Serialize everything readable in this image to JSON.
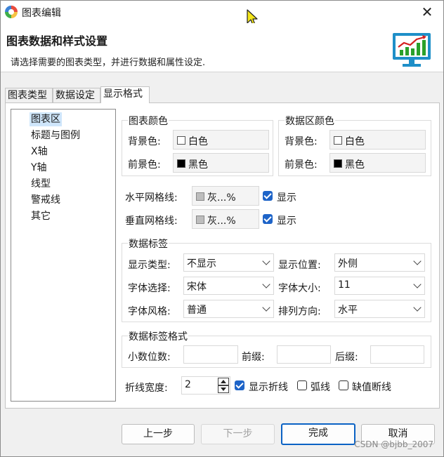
{
  "window": {
    "title": "图表编辑"
  },
  "header": {
    "title": "图表数据和样式设置",
    "subtitle": "请选择需要的图表类型，并进行数据和属性设定."
  },
  "tabs": [
    {
      "label": "图表类型"
    },
    {
      "label": "数据设定"
    },
    {
      "label": "显示格式"
    }
  ],
  "tree": [
    {
      "label": "图表区"
    },
    {
      "label": "标题与图例"
    },
    {
      "label": "X轴"
    },
    {
      "label": "Y轴"
    },
    {
      "label": "线型"
    },
    {
      "label": "警戒线"
    },
    {
      "label": "其它"
    }
  ],
  "chart_color": {
    "group_label": "图表颜色",
    "bg_label": "背景色:",
    "bg_value": "白色",
    "fg_label": "前景色:",
    "fg_value": "黑色"
  },
  "data_area_color": {
    "group_label": "数据区颜色",
    "bg_label": "背景色:",
    "bg_value": "白色",
    "fg_label": "前景色:",
    "fg_value": "黑色"
  },
  "grid": {
    "h_label": "水平网格线:",
    "h_value": "灰...%",
    "h_show_label": "显示",
    "h_show": true,
    "v_label": "垂直网格线:",
    "v_value": "灰...%",
    "v_show_label": "显示",
    "v_show": true
  },
  "data_labels": {
    "group_label": "数据标签",
    "type_label": "显示类型:",
    "type_value": "不显示",
    "position_label": "显示位置:",
    "position_value": "外侧",
    "font_label": "字体选择:",
    "font_value": "宋体",
    "size_label": "字体大小:",
    "size_value": "11",
    "style_label": "字体风格:",
    "style_value": "普通",
    "direction_label": "排列方向:",
    "direction_value": "水平"
  },
  "label_format": {
    "group_label": "数据标签格式",
    "decimal_label": "小数位数:",
    "decimal_value": "",
    "prefix_label": "前缀:",
    "prefix_value": "",
    "suffix_label": "后缀:",
    "suffix_value": ""
  },
  "line": {
    "width_label": "折线宽度:",
    "width_value": "2",
    "show_line_label": "显示折线",
    "show_line": true,
    "arc_label": "弧线",
    "arc": false,
    "break_label": "缺值断线",
    "break": false
  },
  "buttons": {
    "prev": "上一步",
    "next": "下一步",
    "finish": "完成",
    "cancel": "取消"
  },
  "watermark": "CSDN @bjbb_2007",
  "colors": {
    "accent": "#1e64c8",
    "selection": "#cfe6fb",
    "monitor": "#1e8fc8",
    "chart_red": "#d42020",
    "chart_green": "#2aa02a"
  }
}
